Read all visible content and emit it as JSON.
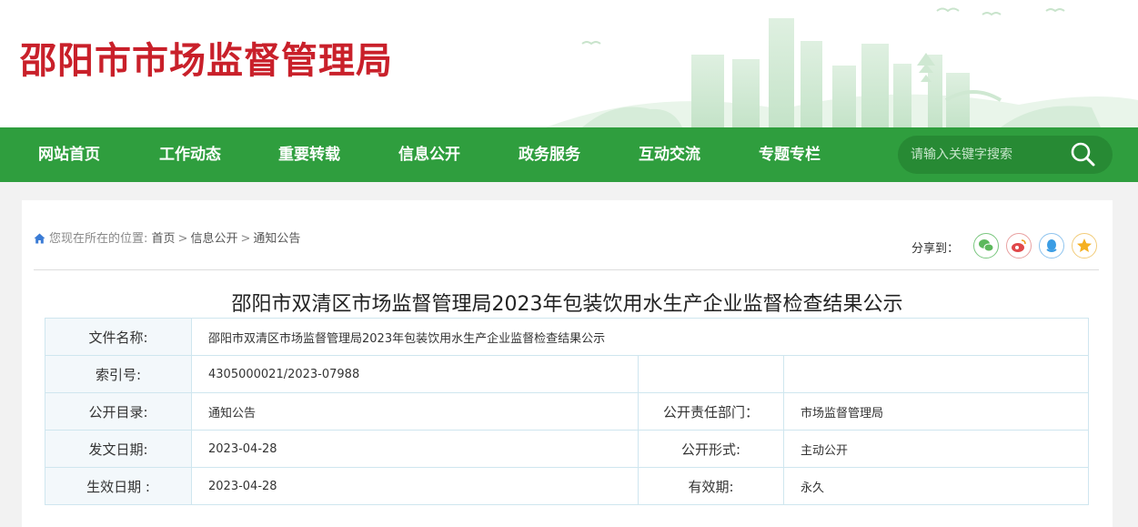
{
  "site": {
    "title": "邵阳市市场监督管理局"
  },
  "nav": {
    "items": [
      "网站首页",
      "工作动态",
      "重要转载",
      "信息公开",
      "政务服务",
      "互动交流",
      "专题专栏"
    ],
    "search_placeholder": "请输入关键字搜索"
  },
  "breadcrumb": {
    "prefix": "您现在所在的位置:",
    "items": [
      "首页",
      "信息公开",
      "通知公告"
    ],
    "separator": ">"
  },
  "share": {
    "label": "分享到：",
    "icons": [
      "wechat-icon",
      "weibo-icon",
      "qq-icon",
      "qzone-icon"
    ]
  },
  "article": {
    "title": "邵阳市双清区市场监督管理局2023年包装饮用水生产企业监督检查结果公示"
  },
  "meta": {
    "file_name_label": "文件名称:",
    "file_name_value": "邵阳市双清区市场监督管理局2023年包装饮用水生产企业监督检查结果公示",
    "index_label": "索引号:",
    "index_value": "4305000021/2023-07988",
    "catalog_label": "公开目录:",
    "catalog_value": "通知公告",
    "dept_label": "公开责任部门：",
    "dept_value": "市场监督管理局",
    "date_label": "发文日期:",
    "date_value": "2023-04-28",
    "form_label": "公开形式:",
    "form_value": "主动公开",
    "effective_label": "生效日期 :",
    "effective_value": "2023-04-28",
    "validity_label": "有效期:",
    "validity_value": "永久"
  },
  "colors": {
    "brand_red": "#c9202a",
    "nav_green": "#2f9e3e",
    "table_border": "#cfe6ef"
  }
}
